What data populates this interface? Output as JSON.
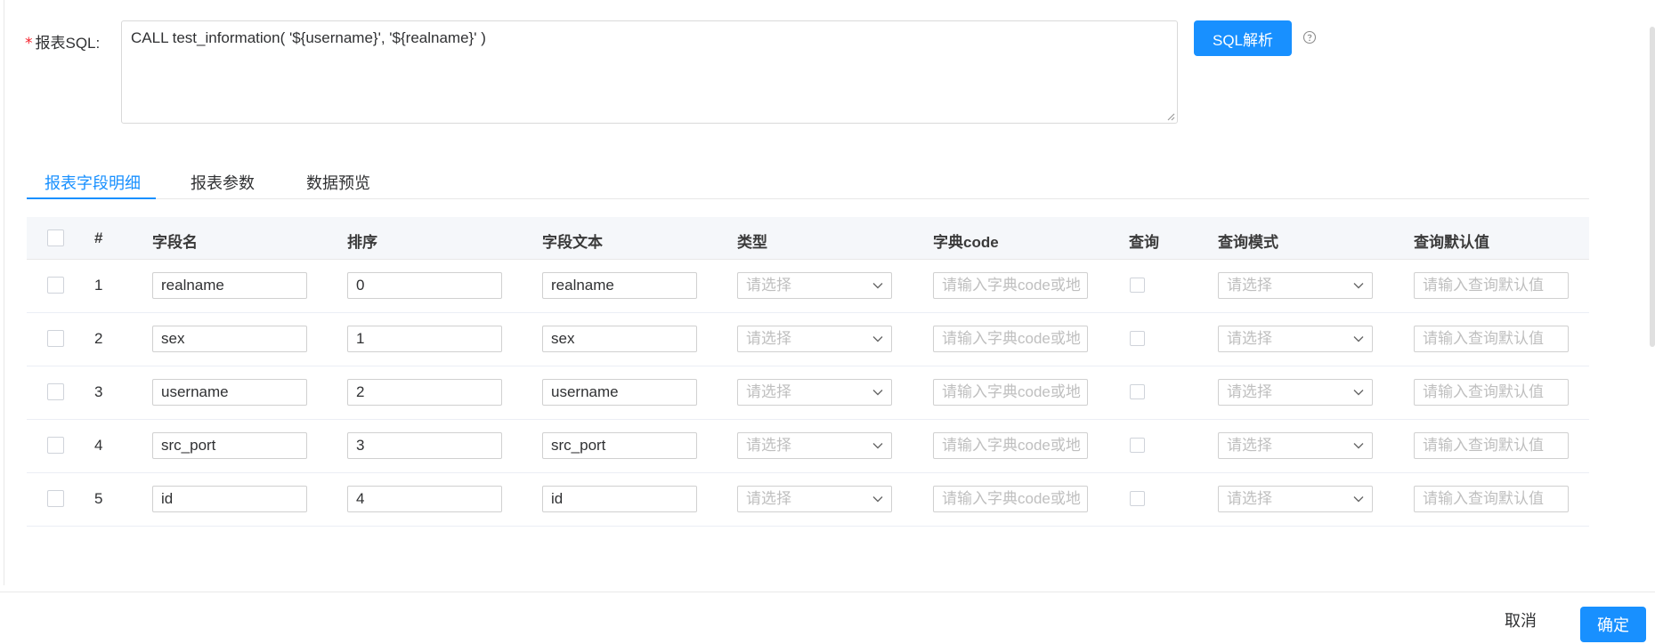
{
  "sql": {
    "required_mark": "*",
    "label": "报表SQL:",
    "value": "CALL test_information( '${username}', '${realname}' )",
    "parse_button": "SQL解析"
  },
  "tabs": [
    {
      "label": "报表字段明细",
      "active": true
    },
    {
      "label": "报表参数",
      "active": false
    },
    {
      "label": "数据预览",
      "active": false
    }
  ],
  "table": {
    "columns": [
      "#",
      "字段名",
      "排序",
      "字段文本",
      "类型",
      "字典code",
      "查询",
      "查询模式",
      "查询默认值"
    ],
    "type_placeholder": "请选择",
    "dict_placeholder": "请输入字典code或地",
    "mode_placeholder": "请选择",
    "default_placeholder": "请输入查询默认值",
    "rows": [
      {
        "index": "1",
        "field_name": "realname",
        "order": "0",
        "field_text": "realname"
      },
      {
        "index": "2",
        "field_name": "sex",
        "order": "1",
        "field_text": "sex"
      },
      {
        "index": "3",
        "field_name": "username",
        "order": "2",
        "field_text": "username"
      },
      {
        "index": "4",
        "field_name": "src_port",
        "order": "3",
        "field_text": "src_port"
      },
      {
        "index": "5",
        "field_name": "id",
        "order": "4",
        "field_text": "id"
      }
    ]
  },
  "footer": {
    "cancel": "取消",
    "ok": "确定"
  },
  "colors": {
    "primary": "#1890ff",
    "required": "#f5222d"
  }
}
